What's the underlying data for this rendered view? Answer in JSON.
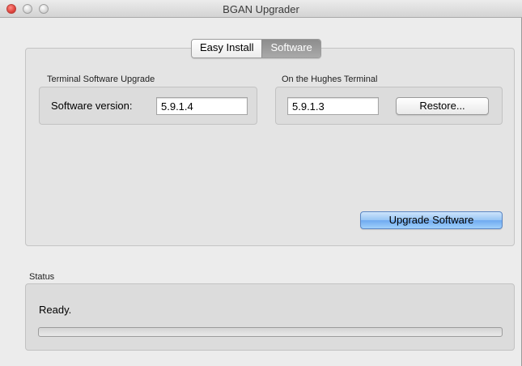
{
  "window": {
    "title": "BGAN Upgrader"
  },
  "tabs": [
    {
      "label": "Easy Install",
      "active": false
    },
    {
      "label": "Software",
      "active": true
    }
  ],
  "terminal_software_upgrade": {
    "group_label": "Terminal Software Upgrade",
    "version_label": "Software version:",
    "version_value": "5.9.1.4"
  },
  "hughes_terminal": {
    "group_label": "On the Hughes Terminal",
    "version_value": "5.9.1.3",
    "restore_label": "Restore..."
  },
  "upgrade_button_label": "Upgrade Software",
  "status": {
    "group_label": "Status",
    "text": "Ready.",
    "progress": 0
  },
  "colors": {
    "accent": "#6faaf0",
    "close_light": "#e0443e"
  }
}
